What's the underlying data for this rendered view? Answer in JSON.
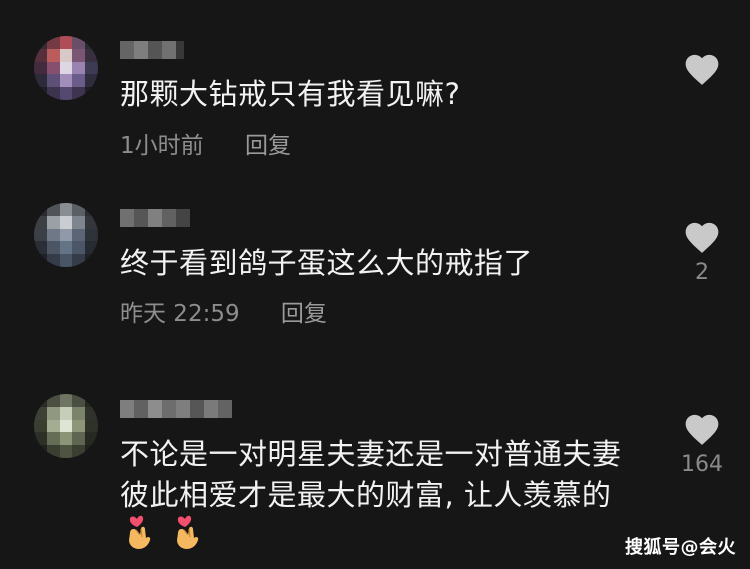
{
  "comments": [
    {
      "text": "那颗大钻戒只有我看见嘛?",
      "time": "1小时前",
      "reply_label": "回复",
      "likes": ""
    },
    {
      "text": "终于看到鸽子蛋这么大的戒指了",
      "time": "昨天 22:59",
      "reply_label": "回复",
      "likes": "2"
    },
    {
      "text_line1": "不论是一对明星夫妻还是一对普通夫妻",
      "text_line2": "彼此相爱才是最大的财富, 让人羡慕的",
      "likes": "164",
      "emojis": [
        "finger-heart-emoji",
        "finger-heart-emoji"
      ]
    }
  ],
  "watermark": "搜狐号@会火",
  "colors": {
    "background": "#161616",
    "text": "#f2f2f2",
    "meta": "#8d8d8d",
    "like_icon": "#c9c9c9"
  }
}
